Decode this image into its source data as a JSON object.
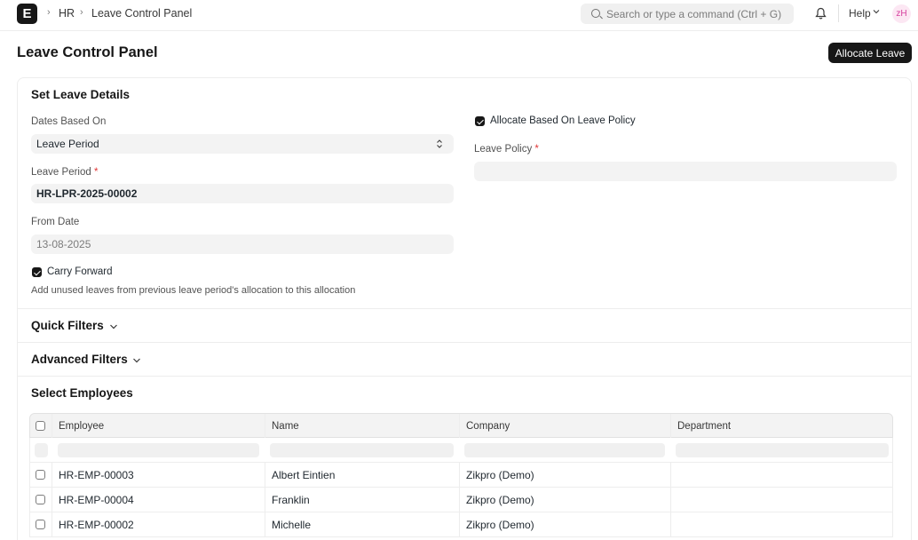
{
  "navbar": {
    "logo_letter": "E",
    "breadcrumbs": [
      "HR",
      "Leave Control Panel"
    ],
    "search_placeholder": "Search or type a command (Ctrl + G)",
    "help_label": "Help",
    "avatar_initials": "zH"
  },
  "page": {
    "title": "Leave Control Panel",
    "primary_action": "Allocate Leave"
  },
  "leave_details": {
    "section_title": "Set Leave Details",
    "dates_based_on": {
      "label": "Dates Based On",
      "value": "Leave Period"
    },
    "leave_period": {
      "label": "Leave Period",
      "required": "*",
      "value": "HR-LPR-2025-00002"
    },
    "from_date": {
      "label": "From Date",
      "value": "13-08-2025"
    },
    "carry_forward": {
      "label": "Carry Forward",
      "checked": true,
      "description": "Add unused leaves from previous leave period's allocation to this allocation"
    },
    "allocate_based_on_policy": {
      "label": "Allocate Based On Leave Policy",
      "checked": true
    },
    "leave_policy": {
      "label": "Leave Policy",
      "required": "*",
      "value": ""
    }
  },
  "sections": {
    "quick_filters": "Quick Filters",
    "advanced_filters": "Advanced Filters",
    "select_employees": "Select Employees"
  },
  "employees_table": {
    "columns": [
      "Employee",
      "Name",
      "Company",
      "Department"
    ],
    "rows": [
      {
        "employee": "HR-EMP-00003",
        "name": "Albert Eintien",
        "company": "Zikpro (Demo)",
        "department": ""
      },
      {
        "employee": "HR-EMP-00004",
        "name": "Franklin",
        "company": "Zikpro (Demo)",
        "department": ""
      },
      {
        "employee": "HR-EMP-00002",
        "name": "Michelle",
        "company": "Zikpro (Demo)",
        "department": ""
      }
    ]
  },
  "colors": {
    "primary": "#171717",
    "control_bg": "#f3f3f3",
    "avatar_bg": "#fce7f3",
    "avatar_text": "#d6409f",
    "required": "#e03636"
  },
  "icons": {
    "logo": "app-logo-icon",
    "search": "search-icon",
    "notifications": "bell-icon",
    "help_dropdown": "chevron-down-icon",
    "select": "select-arrows-icon",
    "collapse": "chevron-down-icon"
  }
}
